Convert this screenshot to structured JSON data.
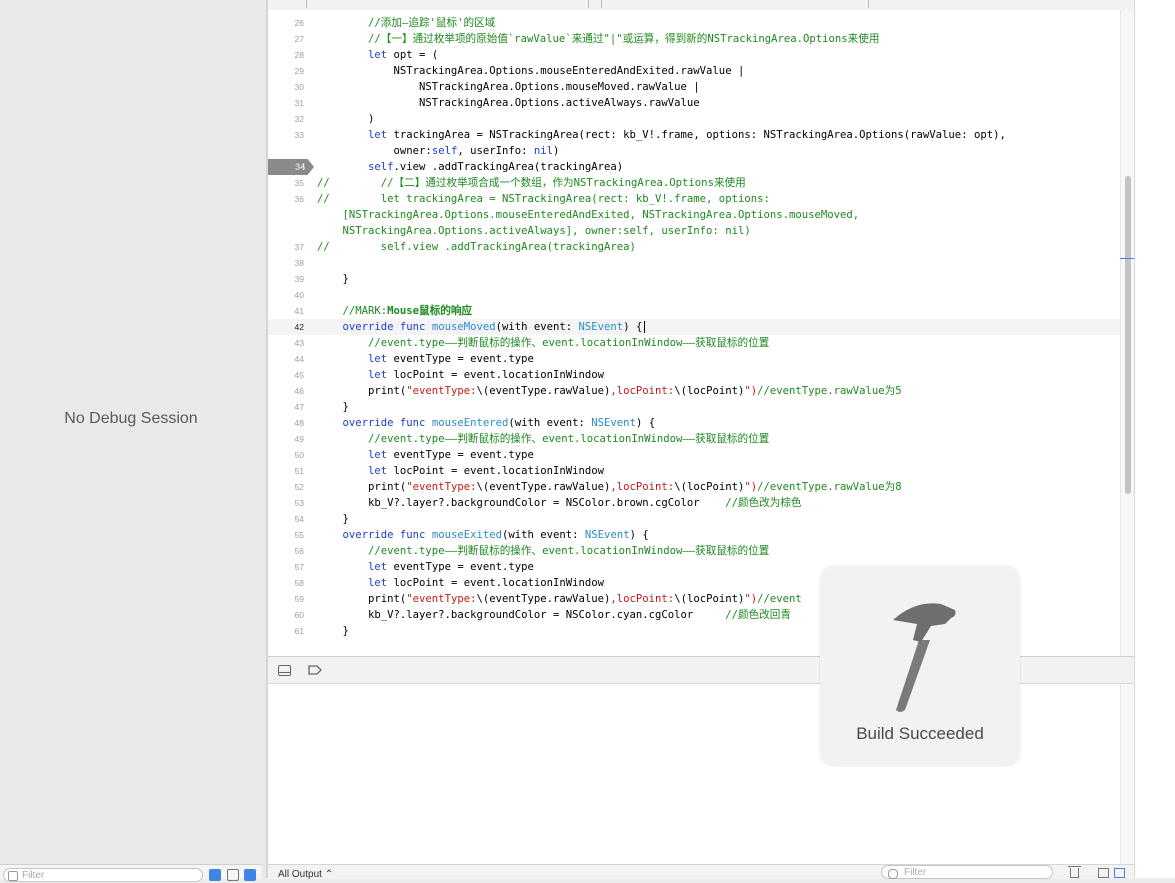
{
  "debug_area": {
    "no_session_text": "No Debug Session"
  },
  "left_filter": {
    "placeholder": "Filter"
  },
  "editor": {
    "current_line": 42,
    "breakpoint_line": 34,
    "lines": [
      {
        "n": "26",
        "segs": [
          {
            "t": "        "
          },
          {
            "t": "//添加—追踪'鼠标'的区域",
            "c": "c-cm"
          }
        ]
      },
      {
        "n": "27",
        "segs": [
          {
            "t": "        "
          },
          {
            "t": "//【一】通过枚举项的原始值`rawValue`来通过\"|\"或运算，得到新的NSTrackingArea.Options来使用",
            "c": "c-cm"
          }
        ]
      },
      {
        "n": "28",
        "segs": [
          {
            "t": "        "
          },
          {
            "t": "let",
            "c": "c-kw"
          },
          {
            "t": " opt = ("
          }
        ]
      },
      {
        "n": "29",
        "segs": [
          {
            "t": "            NSTrackingArea.Options.mouseEnteredAndExited.rawValue |"
          }
        ]
      },
      {
        "n": "30",
        "segs": [
          {
            "t": "                NSTrackingArea.Options.mouseMoved.rawValue |"
          }
        ]
      },
      {
        "n": "31",
        "segs": [
          {
            "t": "                NSTrackingArea.Options.activeAlways.rawValue"
          }
        ]
      },
      {
        "n": "32",
        "segs": [
          {
            "t": "        )"
          }
        ]
      },
      {
        "n": "33",
        "segs": [
          {
            "t": "        "
          },
          {
            "t": "let",
            "c": "c-kw"
          },
          {
            "t": " trackingArea = NSTrackingArea(rect: kb_V!.frame, options: NSTrackingArea.Options(rawValue: opt),"
          }
        ]
      },
      {
        "n": "",
        "segs": [
          {
            "t": "            owner:"
          },
          {
            "t": "self",
            "c": "c-kw"
          },
          {
            "t": ", userInfo: "
          },
          {
            "t": "nil",
            "c": "c-kw"
          },
          {
            "t": ")"
          }
        ]
      },
      {
        "n": "34",
        "segs": [
          {
            "t": "        "
          },
          {
            "t": "self",
            "c": "c-kw"
          },
          {
            "t": ".view .addTrackingArea(trackingArea)"
          }
        ]
      },
      {
        "n": "35",
        "segs": [
          {
            "t": "//        //【二】通过枚举项合成一个数组，作为NSTrackingArea.Options来使用",
            "c": "c-cm"
          }
        ]
      },
      {
        "n": "36",
        "segs": [
          {
            "t": "//        let trackingArea = NSTrackingArea(rect: kb_V!.frame, options:",
            "c": "c-cm"
          }
        ]
      },
      {
        "n": "",
        "segs": [
          {
            "t": "    [NSTrackingArea.Options.mouseEnteredAndExited, NSTrackingArea.Options.mouseMoved,",
            "c": "c-cm"
          }
        ]
      },
      {
        "n": "",
        "segs": [
          {
            "t": "    NSTrackingArea.Options.activeAlways], owner:self, userInfo: nil)",
            "c": "c-cm"
          }
        ]
      },
      {
        "n": "37",
        "segs": [
          {
            "t": "//        self.view .addTrackingArea(trackingArea)",
            "c": "c-cm"
          }
        ]
      },
      {
        "n": "38",
        "segs": [
          {
            "t": ""
          }
        ]
      },
      {
        "n": "39",
        "segs": [
          {
            "t": "    }"
          }
        ]
      },
      {
        "n": "40",
        "segs": [
          {
            "t": ""
          }
        ]
      },
      {
        "n": "41",
        "segs": [
          {
            "t": "    "
          },
          {
            "t": "//MARK:",
            "c": "c-cm"
          },
          {
            "t": "Mouse鼠标的响应",
            "c": "c-cm c-b"
          }
        ]
      },
      {
        "n": "42",
        "segs": [
          {
            "t": "    "
          },
          {
            "t": "override func",
            "c": "c-kw"
          },
          {
            "t": " "
          },
          {
            "t": "mouseMoved",
            "c": "c-ty"
          },
          {
            "t": "(with event: "
          },
          {
            "t": "NSEvent",
            "c": "c-ty"
          },
          {
            "t": ") {"
          }
        ]
      },
      {
        "n": "43",
        "segs": [
          {
            "t": "        "
          },
          {
            "t": "//event.type——判断鼠标的操作、event.locationInWindow——获取鼠标的位置",
            "c": "c-cm"
          }
        ]
      },
      {
        "n": "44",
        "segs": [
          {
            "t": "        "
          },
          {
            "t": "let",
            "c": "c-kw"
          },
          {
            "t": " eventType = event.type"
          }
        ]
      },
      {
        "n": "45",
        "segs": [
          {
            "t": "        "
          },
          {
            "t": "let",
            "c": "c-kw"
          },
          {
            "t": " locPoint = event.locationInWindow"
          }
        ]
      },
      {
        "n": "46",
        "segs": [
          {
            "t": "        print("
          },
          {
            "t": "\"eventType:",
            "c": "c-st"
          },
          {
            "t": "\\(eventType.rawValue)"
          },
          {
            "t": ",locPoint:",
            "c": "c-st"
          },
          {
            "t": "\\(locPoint)"
          },
          {
            "t": "\")",
            "c": "c-st"
          },
          {
            "t": "//eventType.rawValue为5",
            "c": "c-cm"
          }
        ]
      },
      {
        "n": "47",
        "segs": [
          {
            "t": "    }"
          }
        ]
      },
      {
        "n": "48",
        "segs": [
          {
            "t": "    "
          },
          {
            "t": "override func",
            "c": "c-kw"
          },
          {
            "t": " "
          },
          {
            "t": "mouseEntered",
            "c": "c-ty"
          },
          {
            "t": "(with event: "
          },
          {
            "t": "NSEvent",
            "c": "c-ty"
          },
          {
            "t": ") {"
          }
        ]
      },
      {
        "n": "49",
        "segs": [
          {
            "t": "        "
          },
          {
            "t": "//event.type——判断鼠标的操作、event.locationInWindow——获取鼠标的位置",
            "c": "c-cm"
          }
        ]
      },
      {
        "n": "50",
        "segs": [
          {
            "t": "        "
          },
          {
            "t": "let",
            "c": "c-kw"
          },
          {
            "t": " eventType = event.type"
          }
        ]
      },
      {
        "n": "51",
        "segs": [
          {
            "t": "        "
          },
          {
            "t": "let",
            "c": "c-kw"
          },
          {
            "t": " locPoint = event.locationInWindow"
          }
        ]
      },
      {
        "n": "52",
        "segs": [
          {
            "t": "        print("
          },
          {
            "t": "\"eventType:",
            "c": "c-st"
          },
          {
            "t": "\\(eventType.rawValue)"
          },
          {
            "t": ",locPoint:",
            "c": "c-st"
          },
          {
            "t": "\\(locPoint)"
          },
          {
            "t": "\")",
            "c": "c-st"
          },
          {
            "t": "//eventType.rawValue为8",
            "c": "c-cm"
          }
        ]
      },
      {
        "n": "53",
        "segs": [
          {
            "t": "        kb_V?.layer?.backgroundColor = NSColor.brown.cgColor    "
          },
          {
            "t": "//颜色改为棕色",
            "c": "c-cm"
          }
        ]
      },
      {
        "n": "54",
        "segs": [
          {
            "t": "    }"
          }
        ]
      },
      {
        "n": "55",
        "segs": [
          {
            "t": "    "
          },
          {
            "t": "override func",
            "c": "c-kw"
          },
          {
            "t": " "
          },
          {
            "t": "mouseExited",
            "c": "c-ty"
          },
          {
            "t": "(with event: "
          },
          {
            "t": "NSEvent",
            "c": "c-ty"
          },
          {
            "t": ") {"
          }
        ]
      },
      {
        "n": "56",
        "segs": [
          {
            "t": "        "
          },
          {
            "t": "//event.type——判断鼠标的操作、event.locationInWindow——获取鼠标的位置",
            "c": "c-cm"
          }
        ]
      },
      {
        "n": "57",
        "segs": [
          {
            "t": "        "
          },
          {
            "t": "let",
            "c": "c-kw"
          },
          {
            "t": " eventType = event.type"
          }
        ]
      },
      {
        "n": "58",
        "segs": [
          {
            "t": "        "
          },
          {
            "t": "let",
            "c": "c-kw"
          },
          {
            "t": " locPoint = event.locationInWindow"
          }
        ]
      },
      {
        "n": "59",
        "segs": [
          {
            "t": "        print("
          },
          {
            "t": "\"eventType:",
            "c": "c-st"
          },
          {
            "t": "\\(eventType.rawValue)"
          },
          {
            "t": ",locPoint:",
            "c": "c-st"
          },
          {
            "t": "\\(locPoint)"
          },
          {
            "t": "\")",
            "c": "c-st"
          },
          {
            "t": "//event",
            "c": "c-cm"
          }
        ]
      },
      {
        "n": "60",
        "segs": [
          {
            "t": "        kb_V?.layer?.backgroundColor = NSColor.cyan.cgColor     "
          },
          {
            "t": "//颜色改回青",
            "c": "c-cm"
          }
        ]
      },
      {
        "n": "61",
        "segs": [
          {
            "t": "    }"
          }
        ]
      }
    ]
  },
  "console": {
    "output_selector": "All Output ⌃",
    "filter_placeholder": "Filter"
  },
  "hud": {
    "message": "Build Succeeded"
  },
  "colors": {
    "keyword": "#1d3dd1",
    "comment": "#1e8a1e",
    "string": "#c41a16",
    "type": "#2b8ccc",
    "accent": "#3d86e6"
  }
}
